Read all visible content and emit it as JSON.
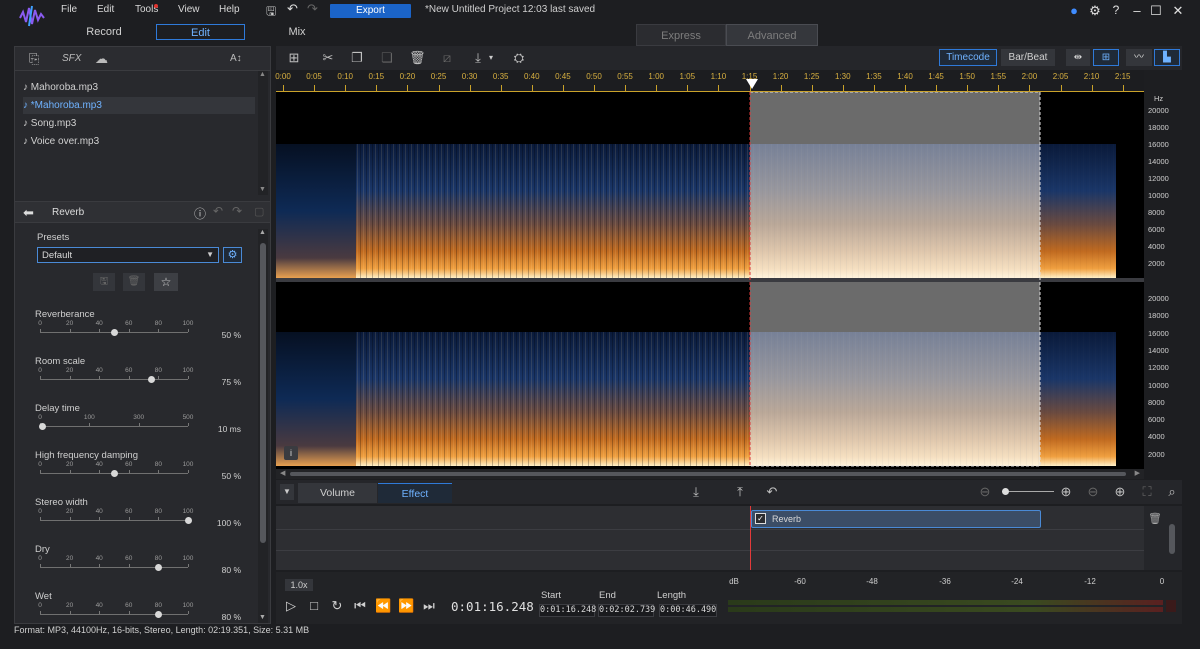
{
  "menu": {
    "file": "File",
    "edit": "Edit",
    "tools": "Tools",
    "view": "View",
    "help": "Help"
  },
  "toolbar": {
    "export_label": "Export",
    "project_title": "*New Untitled Project 12:03 last saved"
  },
  "modes": {
    "record": "Record",
    "edit": "Edit",
    "mix": "Mix",
    "express": "Express",
    "advanced": "Advanced"
  },
  "library": {
    "sfx": "SFX",
    "text_tool": "A↕",
    "files": [
      {
        "name": "Mahoroba.mp3"
      },
      {
        "name": "*Mahoroba.mp3"
      },
      {
        "name": "Song.mp3"
      },
      {
        "name": "Voice over.mp3"
      }
    ]
  },
  "effect": {
    "name": "Reverb",
    "presets_label": "Presets",
    "preset_value": "Default",
    "controls": [
      {
        "label": "Reverberance",
        "value": "50 %",
        "fraction": 0.5,
        "ticks": [
          "0",
          "20",
          "40",
          "60",
          "80",
          "100"
        ]
      },
      {
        "label": "Room scale",
        "value": "75 %",
        "fraction": 0.75,
        "ticks": [
          "0",
          "20",
          "40",
          "60",
          "80",
          "100"
        ]
      },
      {
        "label": "Delay time",
        "value": "10 ms",
        "fraction": 0.02,
        "ticks": [
          "0",
          "100",
          "300",
          "500"
        ]
      },
      {
        "label": "High frequency damping",
        "value": "50 %",
        "fraction": 0.5,
        "ticks": [
          "0",
          "20",
          "40",
          "60",
          "80",
          "100"
        ]
      },
      {
        "label": "Stereo width",
        "value": "100 %",
        "fraction": 1.0,
        "ticks": [
          "0",
          "20",
          "40",
          "60",
          "80",
          "100"
        ]
      },
      {
        "label": "Dry",
        "value": "80 %",
        "fraction": 0.8,
        "ticks": [
          "0",
          "20",
          "40",
          "60",
          "80",
          "100"
        ]
      },
      {
        "label": "Wet",
        "value": "80 %",
        "fraction": 0.8,
        "ticks": [
          "0",
          "20",
          "40",
          "60",
          "80",
          "100"
        ]
      }
    ]
  },
  "view": {
    "timecode": "Timecode",
    "barbeat": "Bar/Beat"
  },
  "ruler": {
    "labels": [
      "0:00",
      "0:05",
      "0:10",
      "0:15",
      "0:20",
      "0:25",
      "0:30",
      "0:35",
      "0:40",
      "0:45",
      "0:50",
      "0:55",
      "1:00",
      "1:05",
      "1:10",
      "1:15",
      "1:20",
      "1:25",
      "1:30",
      "1:35",
      "1:40",
      "1:45",
      "1:50",
      "1:55",
      "2:00",
      "2:05",
      "2:10",
      "2:15"
    ]
  },
  "freq_axis": {
    "unit": "Hz",
    "top_labels": [
      "20000",
      "18000",
      "16000",
      "14000",
      "12000",
      "10000",
      "8000",
      "6000",
      "4000",
      "2000"
    ],
    "bottom_labels": [
      "20000",
      "18000",
      "16000",
      "14000",
      "12000",
      "10000",
      "8000",
      "6000",
      "4000",
      "2000"
    ]
  },
  "info_icon": "i",
  "bottom_tabs": {
    "volume": "Volume",
    "effect": "Effect"
  },
  "clip": {
    "label": "Reverb"
  },
  "transport": {
    "speed": "1.0x",
    "current_time": "0:01:16.248",
    "start_label": "Start",
    "start_value": "0:01:16.248",
    "end_label": "End",
    "end_value": "0:02:02.739",
    "length_label": "Length",
    "length_value": "0:00:46.490",
    "db_labels": [
      "dB",
      "-60",
      "-48",
      "-36",
      "-24",
      "-12",
      "0"
    ]
  },
  "status": {
    "text": "Format: MP3, 44100Hz, 16-bits, Stereo, Length: 02:19.351, Size: 5.31 MB"
  },
  "colors": {
    "accent": "#1b64c8",
    "accent_text": "#6fb2ff",
    "selection": "#6b6b6b",
    "playhead": "#e23a3a"
  }
}
